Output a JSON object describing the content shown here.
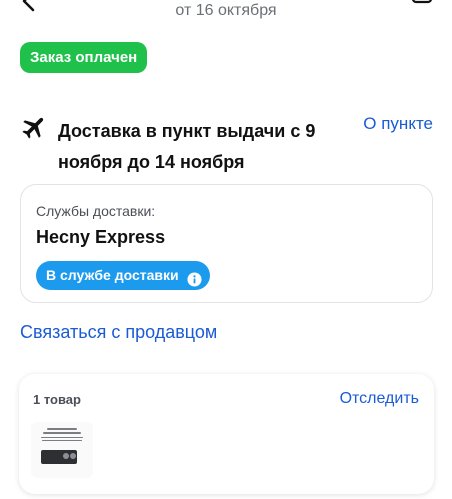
{
  "header": {
    "order_date": "от 16 октября",
    "back_icon": "chevron-left-icon",
    "share_icon": "share-icon"
  },
  "status": {
    "label": "Заказ оплачен",
    "color": "#1fc14b"
  },
  "delivery": {
    "icon": "airplane-icon",
    "title": "Доставка в пункт выдачи с 9 ноября до 14 ноября",
    "pickup_link": "О пункте"
  },
  "service_card": {
    "label": "Службы доставки:",
    "name": "Hecny Express",
    "chip_label": "В службе доставки",
    "chip_color": "#1c9bee",
    "chip_icon": "info-icon"
  },
  "contact": {
    "label": "Связаться с продавцом"
  },
  "items_card": {
    "count_label": "1 товар",
    "track_label": "Отследить",
    "product_icon": "product-thumbnail"
  },
  "colors": {
    "accent": "#1a5bd6",
    "status": "#1fc14b",
    "chip": "#1c9bee"
  }
}
